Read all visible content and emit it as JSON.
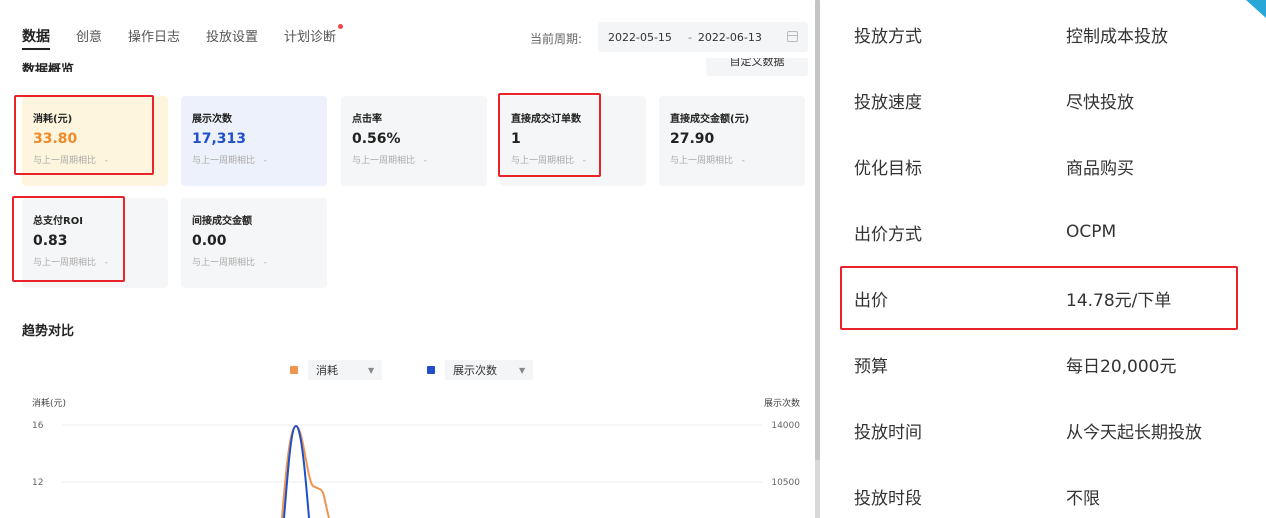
{
  "tabs": [
    {
      "label": "数据",
      "active": true
    },
    {
      "label": "创意",
      "active": false
    },
    {
      "label": "操作日志",
      "active": false
    },
    {
      "label": "投放设置",
      "active": false
    },
    {
      "label": "计划诊断",
      "active": false,
      "dot": true
    }
  ],
  "period": {
    "label": "当前周期:",
    "start": "2022-05-15",
    "separator": "-",
    "end": "2022-06-13"
  },
  "overview": {
    "title_partial": "数据概览",
    "custom_button_partial": "自定义数据"
  },
  "metrics": [
    {
      "label": "消耗(元)",
      "value": "33.80",
      "compare": "与上一周期相比",
      "compare_value": "-",
      "style": "orange",
      "highlighted": true
    },
    {
      "label": "展示次数",
      "value": "17,313",
      "compare": "与上一周期相比",
      "compare_value": "-",
      "style": "blue",
      "highlighted": false
    },
    {
      "label": "点击率",
      "value": "0.56%",
      "compare": "与上一周期相比",
      "compare_value": "-",
      "style": "gray",
      "highlighted": false
    },
    {
      "label": "直接成交订单数",
      "value": "1",
      "compare": "与上一周期相比",
      "compare_value": "-",
      "style": "gray",
      "highlighted": true
    },
    {
      "label": "直接成交金额(元)",
      "value": "27.90",
      "compare": "与上一周期相比",
      "compare_value": "-",
      "style": "gray",
      "highlighted": false
    },
    {
      "label": "总支付ROI",
      "value": "0.83",
      "compare": "与上一周期相比",
      "compare_value": "-",
      "style": "gray",
      "highlighted": true
    },
    {
      "label": "间接成交金额",
      "value": "0.00",
      "compare": "与上一周期相比",
      "compare_value": "-",
      "style": "gray",
      "highlighted": false
    }
  ],
  "trend": {
    "title": "趋势对比",
    "legend": [
      {
        "label": "消耗",
        "color": "#ef9550"
      },
      {
        "label": "展示次数",
        "color": "#1f4fc9"
      }
    ]
  },
  "chart_data": {
    "type": "line",
    "title": "",
    "left_axis_label": "消耗(元)",
    "right_axis_label": "展示次数",
    "left_ticks": [
      16,
      12
    ],
    "right_ticks": [
      14000,
      10500
    ],
    "series": [
      {
        "name": "消耗",
        "color": "#ef9550",
        "axis": "left",
        "peak": 16
      },
      {
        "name": "展示次数",
        "color": "#1f4fc9",
        "axis": "right",
        "peak": 14000
      }
    ]
  },
  "settings": [
    {
      "key": "投放方式",
      "value": "控制成本投放",
      "highlighted": false
    },
    {
      "key": "投放速度",
      "value": "尽快投放",
      "highlighted": false
    },
    {
      "key": "优化目标",
      "value": "商品购买",
      "highlighted": false
    },
    {
      "key": "出价方式",
      "value": "OCPM",
      "highlighted": false
    },
    {
      "key": "出价",
      "value": "14.78元/下单",
      "highlighted": true
    },
    {
      "key": "预算",
      "value": "每日20,000元",
      "highlighted": false
    },
    {
      "key": "投放时间",
      "value": "从今天起长期投放",
      "highlighted": false
    },
    {
      "key": "投放时段",
      "value": "不限",
      "highlighted": false
    }
  ],
  "colors": {
    "highlight": "#e8242a",
    "orange_accent": "#ee8a2a",
    "blue_accent": "#1f4fc9"
  }
}
